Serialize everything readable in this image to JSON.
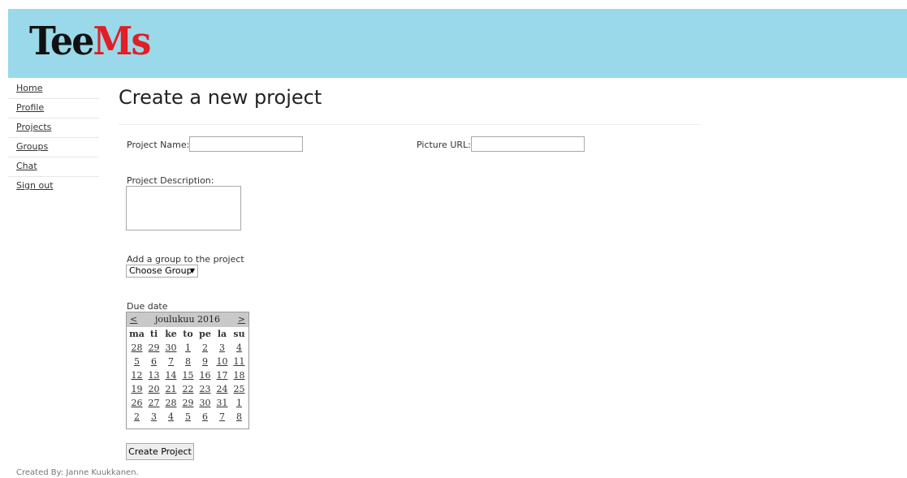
{
  "header": {
    "logo_part1": "Tee",
    "logo_part2": "Ms"
  },
  "nav": [
    "Home",
    "Profile",
    "Projects",
    "Groups",
    "Chat",
    "Sign out"
  ],
  "page_title": "Create a new project",
  "form": {
    "project_name_label": "Project Name:",
    "project_name_value": "",
    "picture_url_label": "Picture URL:",
    "picture_url_value": "",
    "description_label": "Project Description:",
    "description_value": "",
    "group_label": "Add a group to the project",
    "group_selected": "Choose Group",
    "due_date_label": "Due date",
    "submit_label": "Create Project"
  },
  "calendar": {
    "prev": "<",
    "next": ">",
    "month_label": "joulukuu 2016",
    "weekdays": [
      "ma",
      "ti",
      "ke",
      "to",
      "pe",
      "la",
      "su"
    ],
    "weeks": [
      [
        "28",
        "29",
        "30",
        "1",
        "2",
        "3",
        "4"
      ],
      [
        "5",
        "6",
        "7",
        "8",
        "9",
        "10",
        "11"
      ],
      [
        "12",
        "13",
        "14",
        "15",
        "16",
        "17",
        "18"
      ],
      [
        "19",
        "20",
        "21",
        "22",
        "23",
        "24",
        "25"
      ],
      [
        "26",
        "27",
        "28",
        "29",
        "30",
        "31",
        "1"
      ],
      [
        "2",
        "3",
        "4",
        "5",
        "6",
        "7",
        "8"
      ]
    ]
  },
  "footer": "Created By: Janne Kuukkanen."
}
